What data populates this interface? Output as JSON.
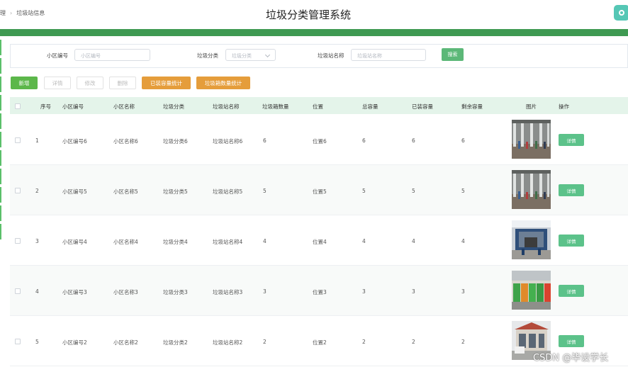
{
  "header": {
    "breadcrumb_first": "理",
    "breadcrumb_current": "垃圾站信息",
    "app_title": "垃圾分类管理系统"
  },
  "search": {
    "community_code_label": "小区编号",
    "community_code_placeholder": "小区编号",
    "category_label": "垃圾分类",
    "category_placeholder": "垃圾分类",
    "station_name_label": "垃圾站名称",
    "station_name_placeholder": "垃圾站名称",
    "search_button": "搜索"
  },
  "toolbar": {
    "add": "新增",
    "detail": "详情",
    "edit": "修改",
    "delete": "删除",
    "loaded_capacity_stats": "已装容量统计",
    "bin_count_stats": "垃圾箱数量统计"
  },
  "table": {
    "columns": [
      "序号",
      "小区编号",
      "小区名称",
      "垃圾分类",
      "垃圾站名称",
      "垃圾箱数量",
      "位置",
      "总容量",
      "已装容量",
      "剩余容量",
      "图片",
      "操作"
    ],
    "rows": [
      {
        "index": "1",
        "community_code": "小区编号6",
        "community_name": "小区名称6",
        "category": "垃圾分类6",
        "station_name": "垃圾站名称6",
        "bin_count": "6",
        "location": "位置6",
        "total_capacity": "6",
        "loaded_capacity": "6",
        "remaining_capacity": "6",
        "detail_button": "详情",
        "image": "garbage-hall-photo"
      },
      {
        "index": "2",
        "community_code": "小区编号5",
        "community_name": "小区名称5",
        "category": "垃圾分类5",
        "station_name": "垃圾站名称5",
        "bin_count": "5",
        "location": "位置5",
        "total_capacity": "5",
        "loaded_capacity": "5",
        "remaining_capacity": "5",
        "detail_button": "详情",
        "image": "garbage-hall-photo"
      },
      {
        "index": "3",
        "community_code": "小区编号4",
        "community_name": "小区名称4",
        "category": "垃圾分类4",
        "station_name": "垃圾站名称4",
        "bin_count": "4",
        "location": "位置4",
        "total_capacity": "4",
        "loaded_capacity": "4",
        "remaining_capacity": "4",
        "detail_button": "详情",
        "image": "compactor-station-photo"
      },
      {
        "index": "4",
        "community_code": "小区编号3",
        "community_name": "小区名称3",
        "category": "垃圾分类3",
        "station_name": "垃圾站名称3",
        "bin_count": "3",
        "location": "位置3",
        "total_capacity": "3",
        "loaded_capacity": "3",
        "remaining_capacity": "3",
        "detail_button": "详情",
        "image": "green-bins-photo"
      },
      {
        "index": "5",
        "community_code": "小区编号2",
        "community_name": "小区名称2",
        "category": "垃圾分类2",
        "station_name": "垃圾站名称2",
        "bin_count": "2",
        "location": "位置2",
        "total_capacity": "2",
        "loaded_capacity": "2",
        "remaining_capacity": "2",
        "detail_button": "详情",
        "image": "outdoor-station-photo"
      }
    ]
  },
  "watermark": "CSDN @毕设学长",
  "colors": {
    "primary_green": "#5cb878",
    "header_band": "#3f9a52",
    "orange": "#e59d3b",
    "table_header_bg": "#e4f4ea"
  }
}
